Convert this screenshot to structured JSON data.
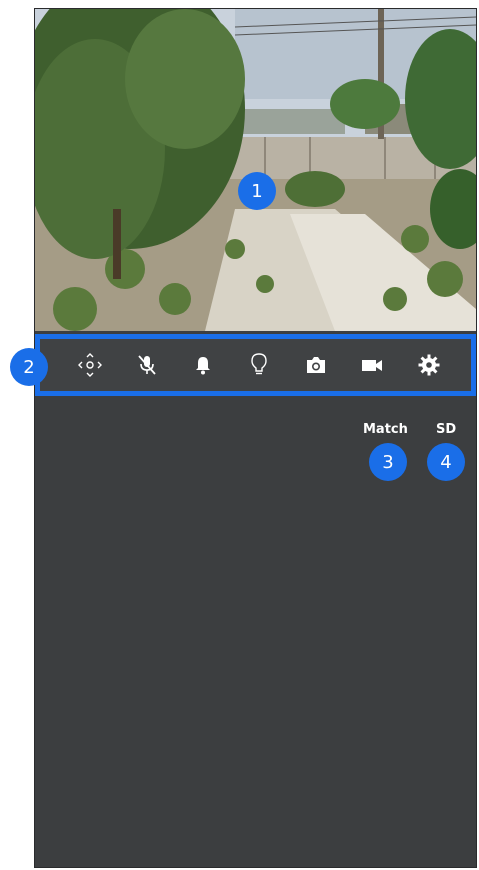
{
  "video": {
    "description_icon": "camera-feed"
  },
  "toolbar": {
    "items": [
      {
        "icon": "pan-tilt-icon"
      },
      {
        "icon": "mic-muted-icon"
      },
      {
        "icon": "bell-icon"
      },
      {
        "icon": "lightbulb-icon"
      },
      {
        "icon": "camera-icon"
      },
      {
        "icon": "video-camera-icon"
      },
      {
        "icon": "gear-icon"
      }
    ]
  },
  "options": {
    "match_label": "Match",
    "sd_label": "SD"
  },
  "callouts": {
    "one": "1",
    "two": "2",
    "three": "3",
    "four": "4"
  },
  "colors": {
    "accent": "#1a6ee8",
    "panel": "#3c3e40"
  }
}
